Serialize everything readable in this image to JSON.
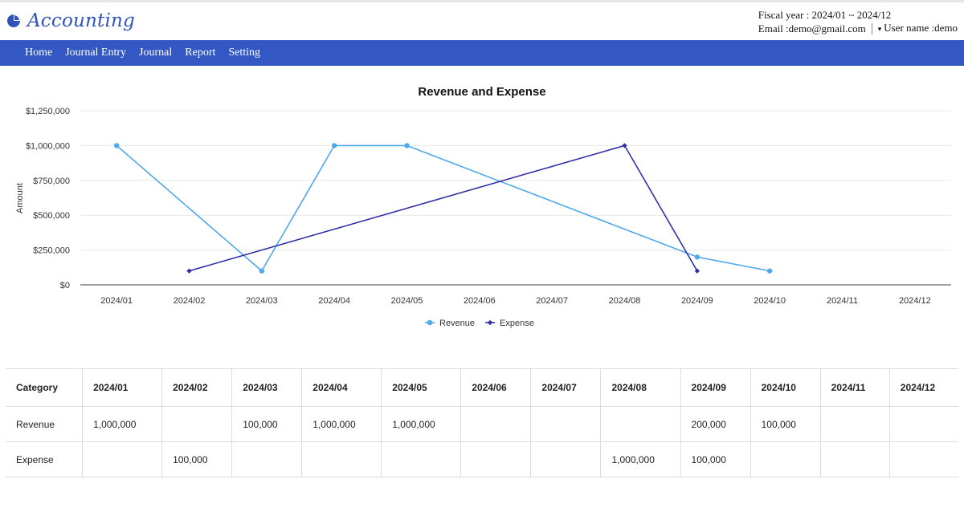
{
  "app": {
    "title": "Accounting",
    "fiscal_year": "Fiscal year : 2024/01 ~ 2024/12",
    "email": "Email :demo@gmail.com",
    "user": "User name :demo",
    "brand_color": "#3358c4"
  },
  "nav": {
    "items": [
      {
        "label": "Home"
      },
      {
        "label": "Journal Entry"
      },
      {
        "label": "Journal"
      },
      {
        "label": "Report"
      },
      {
        "label": "Setting"
      }
    ]
  },
  "chart_data": {
    "type": "line",
    "title": "Revenue and Expense",
    "ylabel": "Amount",
    "xlabel": "",
    "categories": [
      "2024/01",
      "2024/02",
      "2024/03",
      "2024/04",
      "2024/05",
      "2024/06",
      "2024/07",
      "2024/08",
      "2024/09",
      "2024/10",
      "2024/11",
      "2024/12"
    ],
    "ylim": [
      0,
      1250000
    ],
    "yticks": [
      0,
      250000,
      500000,
      750000,
      1000000,
      1250000
    ],
    "ytick_labels": [
      "$0",
      "$250,000",
      "$500,000",
      "$750,000",
      "$1,000,000",
      "$1,250,000"
    ],
    "grid": true,
    "legend": "bottom",
    "series": [
      {
        "name": "Revenue",
        "color": "#4ea8ec",
        "marker": "circle",
        "values": [
          1000000,
          null,
          100000,
          1000000,
          1000000,
          null,
          null,
          null,
          200000,
          100000,
          null,
          null
        ]
      },
      {
        "name": "Expense",
        "color": "#2f2fa8",
        "marker": "diamond",
        "values": [
          null,
          100000,
          null,
          null,
          null,
          null,
          null,
          1000000,
          100000,
          null,
          null,
          null
        ]
      }
    ]
  },
  "table": {
    "headers": [
      "Category",
      "2024/01",
      "2024/02",
      "2024/03",
      "2024/04",
      "2024/05",
      "2024/06",
      "2024/07",
      "2024/08",
      "2024/09",
      "2024/10",
      "2024/11",
      "2024/12"
    ],
    "rows": [
      [
        "Revenue",
        "1,000,000",
        "",
        "100,000",
        "1,000,000",
        "1,000,000",
        "",
        "",
        "",
        "200,000",
        "100,000",
        "",
        ""
      ],
      [
        "Expense",
        "",
        "100,000",
        "",
        "",
        "",
        "",
        "",
        "1,000,000",
        "100,000",
        "",
        "",
        ""
      ]
    ]
  }
}
